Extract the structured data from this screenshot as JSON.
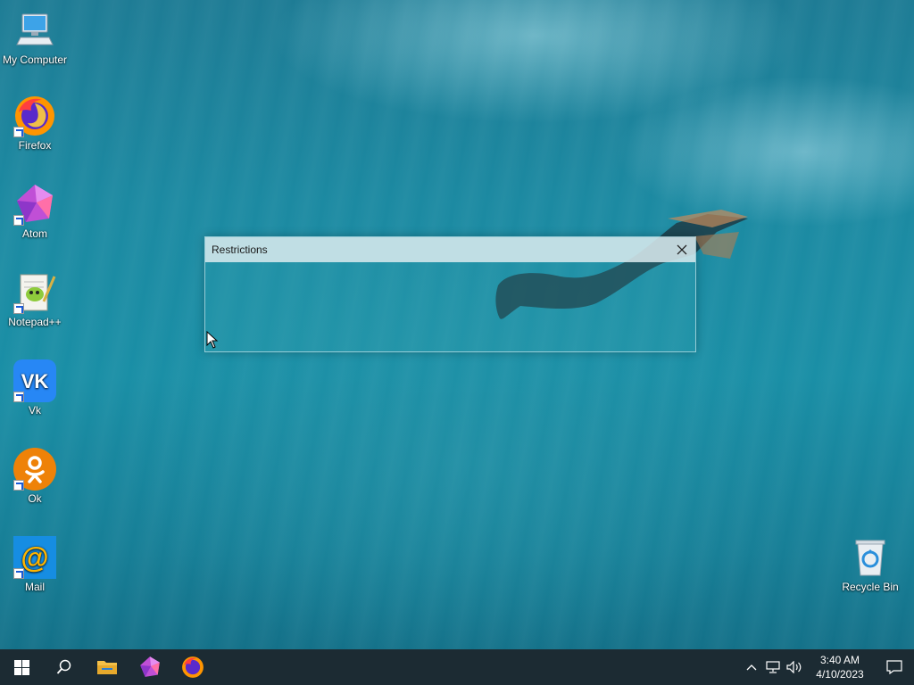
{
  "desktop": {
    "icons": [
      {
        "label": "My Computer",
        "icon": "computer-icon"
      },
      {
        "label": "Firefox",
        "icon": "firefox-icon"
      },
      {
        "label": "Atom",
        "icon": "atom-icon"
      },
      {
        "label": "Notepad++",
        "icon": "notepad-plus-plus-icon"
      },
      {
        "label": "Vk",
        "icon": "vk-icon"
      },
      {
        "label": "Ok",
        "icon": "ok-icon"
      },
      {
        "label": "Mail",
        "icon": "mail-icon"
      }
    ],
    "recycle_bin": {
      "label": "Recycle Bin",
      "icon": "recycle-bin-icon"
    }
  },
  "dialog": {
    "title": "Restrictions",
    "close_icon": "close-icon"
  },
  "taskbar": {
    "pinned": [
      {
        "name": "file-explorer",
        "icon": "folder-icon"
      },
      {
        "name": "atom",
        "icon": "atom-icon"
      },
      {
        "name": "firefox",
        "icon": "firefox-icon"
      }
    ],
    "clock": {
      "time": "3:40 AM",
      "date": "4/10/2023"
    }
  },
  "colors": {
    "taskbar": "#1c2b33",
    "vk": "#2787f5",
    "ok": "#ee8208",
    "mail": "#168de2",
    "folder": "#f4c048"
  }
}
